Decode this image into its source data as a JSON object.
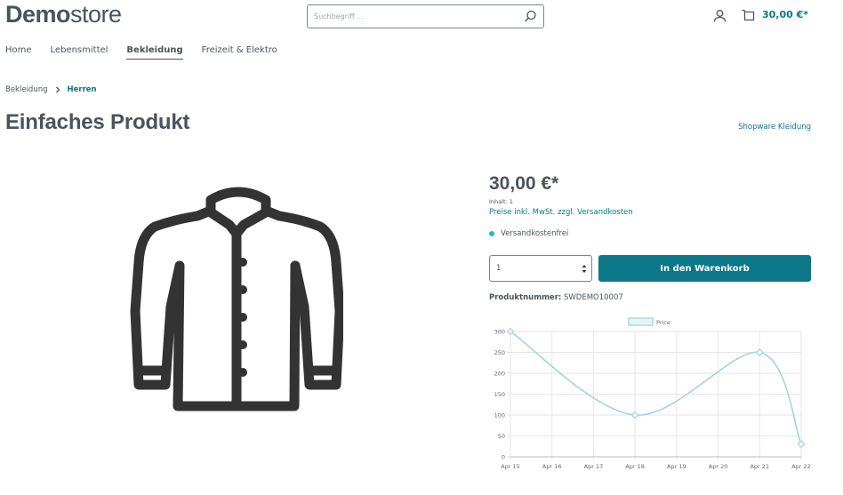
{
  "header": {
    "logo_bold": "Demo",
    "logo_light": "store",
    "search_placeholder": "Suchbegriff ...",
    "cart_total": "30,00 €*"
  },
  "nav": [
    "Home",
    "Lebensmittel",
    "Bekleidung",
    "Freizeit & Elektro"
  ],
  "breadcrumb": [
    "Bekleidung",
    "Herren"
  ],
  "product": {
    "title": "Einfaches Produkt",
    "manufacturer": "Shopware Kleidung",
    "price": "30,00 €*",
    "content": "Inhalt: 1",
    "tax_note": "Preise inkl. MwSt. zzgl. Versandkosten",
    "shipping": "Versandkostenfrei",
    "quantity": "1",
    "add_to_cart": "In den Warenkorb",
    "number_label": "Produktnummer:",
    "number_value": "SWDEMO10007"
  },
  "colors": {
    "accent": "#0b7789",
    "text": "#4a545b",
    "shipping_dot": "#26b6cf",
    "line": "#9dd4da"
  },
  "chart_data": {
    "type": "line",
    "legend": [
      "Price"
    ],
    "x": [
      "Apr 15",
      "Apr 16",
      "Apr 17",
      "Apr 18",
      "Apr 19",
      "Apr 20",
      "Apr 21",
      "Apr 22"
    ],
    "yticks": [
      0,
      50,
      100,
      150,
      200,
      250,
      300
    ],
    "ylim": [
      0,
      300
    ],
    "series": [
      {
        "name": "Price",
        "points": [
          {
            "x": "Apr 15",
            "y": 300
          },
          {
            "x": "Apr 18",
            "y": 100
          },
          {
            "x": "Apr 21",
            "y": 250
          },
          {
            "x": "Apr 22",
            "y": 30
          }
        ]
      }
    ],
    "legend_position": "top",
    "grid": true
  }
}
